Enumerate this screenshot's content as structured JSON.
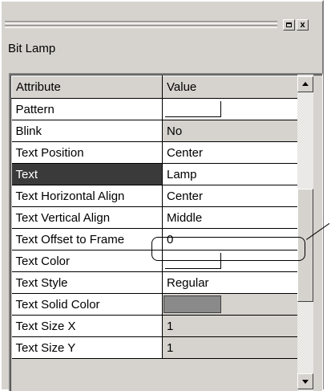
{
  "window": {
    "title": "Bit Lamp",
    "restore_glyph": "□",
    "close_glyph": "x"
  },
  "grid": {
    "header": {
      "attribute": "Attribute",
      "value": "Value"
    },
    "rows": [
      {
        "attribute": "Pattern",
        "value": "",
        "kind": "swatch",
        "swatch_color": "#ffffff"
      },
      {
        "attribute": "Blink",
        "value": "No",
        "kind": "text",
        "readonly": true
      },
      {
        "attribute": "Text Position",
        "value": "Center",
        "kind": "text"
      },
      {
        "attribute": "Text",
        "value": "Lamp",
        "kind": "text",
        "selected": true
      },
      {
        "attribute": "Text Horizontal Align",
        "value": "Center",
        "kind": "text"
      },
      {
        "attribute": "Text Vertical Align",
        "value": "Middle",
        "kind": "text"
      },
      {
        "attribute": "Text Offset to Frame",
        "value": "0",
        "kind": "text"
      },
      {
        "attribute": "Text Color",
        "value": "",
        "kind": "swatch",
        "swatch_color": "#ffffff"
      },
      {
        "attribute": "Text Style",
        "value": "Regular",
        "kind": "text"
      },
      {
        "attribute": "Text Solid Color",
        "value": "",
        "kind": "swatch",
        "swatch_color": "#8a8a8a",
        "readonly": true
      },
      {
        "attribute": "Text Size X",
        "value": "1",
        "kind": "text",
        "readonly": true
      },
      {
        "attribute": "Text Size Y",
        "value": "1",
        "kind": "text",
        "readonly": true
      }
    ]
  },
  "scrollbar": {
    "up_icon": "scroll-up-arrow",
    "down_icon": "scroll-down-arrow"
  },
  "colors": {
    "panel": "#d6d3ce",
    "selected_row": "#3a3a3a",
    "readonly_value": "#d6d3ce"
  }
}
